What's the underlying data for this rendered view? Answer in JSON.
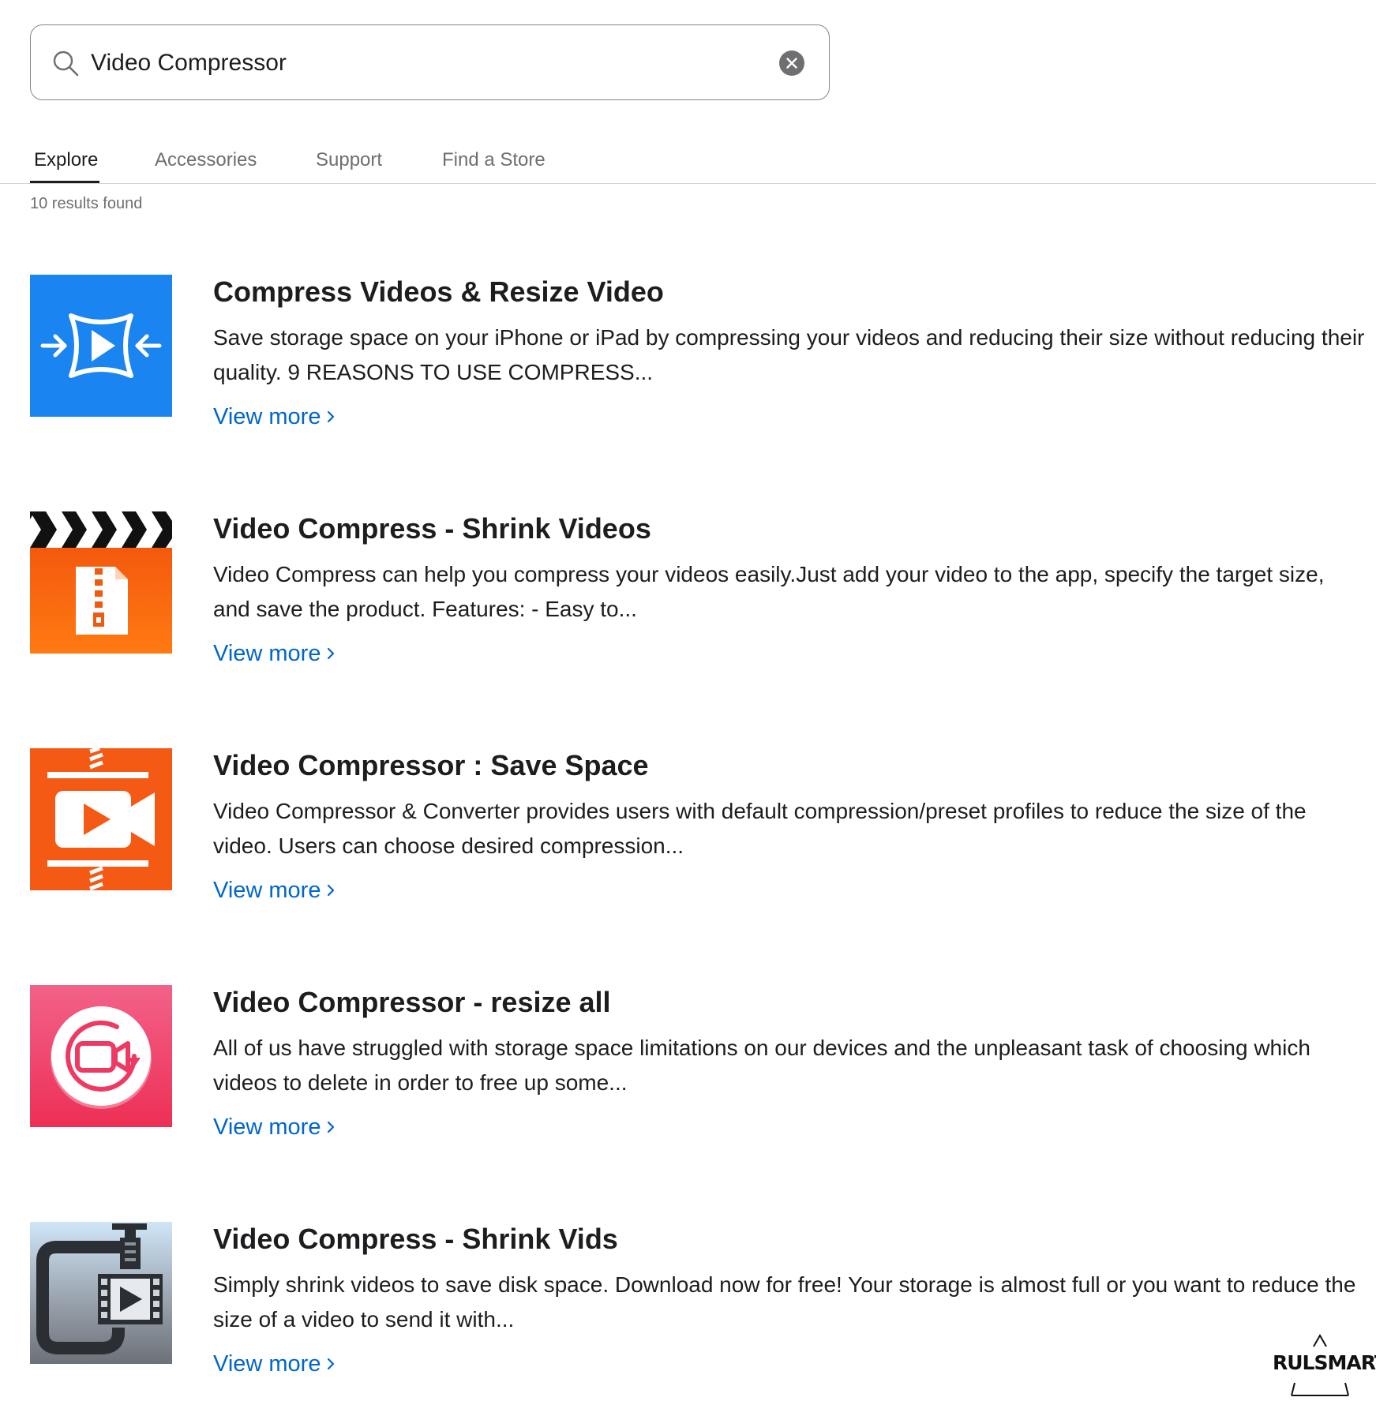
{
  "search": {
    "value": "Video Compressor",
    "icon": "search-icon",
    "clear_icon": "clear-icon"
  },
  "tabs": [
    {
      "label": "Explore",
      "active": true
    },
    {
      "label": "Accessories",
      "active": false
    },
    {
      "label": "Support",
      "active": false
    },
    {
      "label": "Find a Store",
      "active": false
    }
  ],
  "results_count": "10 results found",
  "results": [
    {
      "title": "Compress Videos & Resize Video",
      "description": "Save storage space on your iPhone or iPad by compressing your videos and reducing their size without reducing their quality. 9 REASONS TO USE COMPRESS...",
      "link": "View more",
      "icon": "compress-arrows-icon",
      "color": "#1a84f0"
    },
    {
      "title": "Video Compress - Shrink Videos",
      "description": "Video Compress can help you compress your videos easily.Just add your video to the app, specify the target size, and save the product. Features: - Easy to...",
      "link": "View more",
      "icon": "clapperboard-zip-icon",
      "color": "#f05a10"
    },
    {
      "title": "Video Compressor : Save Space",
      "description": "Video Compressor & Converter provides users with default compression/preset profiles to reduce the size of the video. Users can choose desired compression...",
      "link": "View more",
      "icon": "video-camera-compress-icon",
      "color": "#f45a14"
    },
    {
      "title": "Video Compressor - resize all",
      "description": "All of us have struggled with storage space limitations on our devices and the unpleasant task of choosing which videos to delete in order to free up some...",
      "link": "View more",
      "icon": "video-camera-circle-icon",
      "color": "#ee3a63"
    },
    {
      "title": "Video Compress - Shrink Vids",
      "description": "Simply shrink videos to save disk space. Download now for free! Your storage is almost full or you want to reduce the size of a video to send it with...",
      "link": "View more",
      "icon": "clamp-film-icon",
      "color": "#8a8e95"
    }
  ],
  "watermark": {
    "text": "RULSMART",
    "icon": "triangle-logo-icon"
  }
}
